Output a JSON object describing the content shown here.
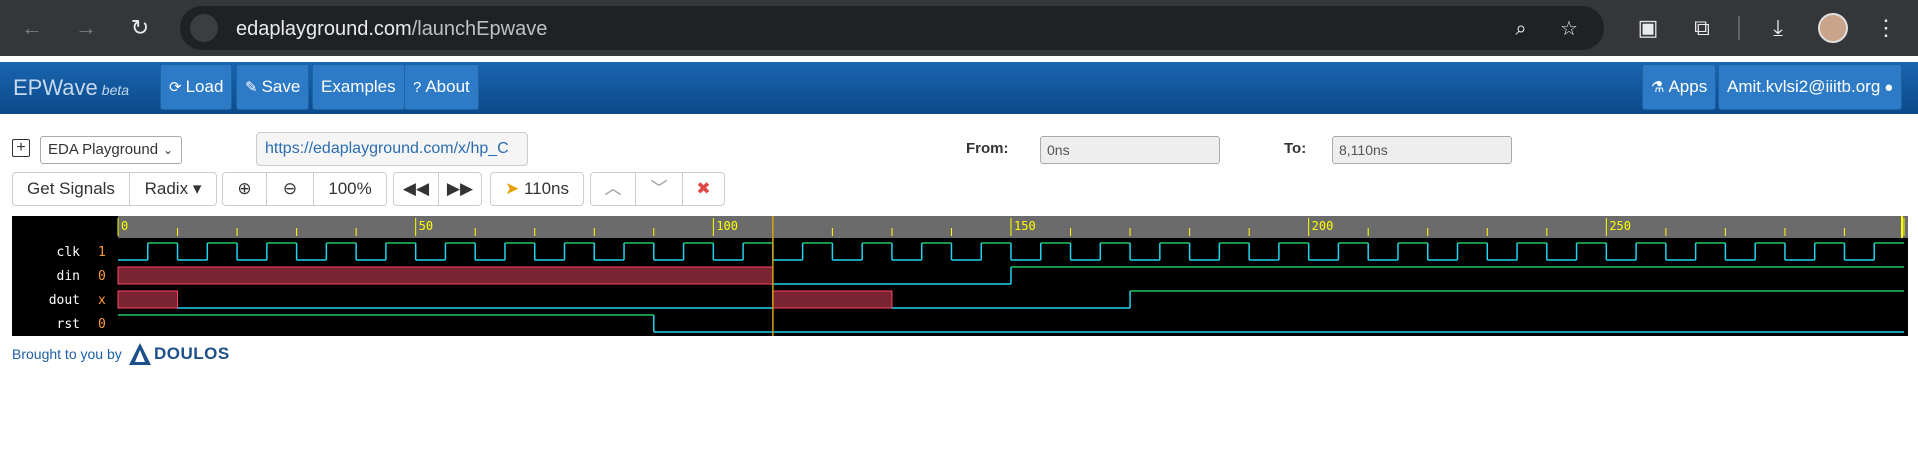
{
  "browser": {
    "url_domain": "edaplayground.com",
    "url_path": "/launchEpwave"
  },
  "app": {
    "brand": "EPWave",
    "brand_tag": "beta",
    "nav": {
      "load": "Load",
      "save": "Save",
      "examples": "Examples",
      "about": "About",
      "apps": "Apps",
      "user": "Amit.kvlsi2@iiitb.org"
    }
  },
  "controls": {
    "source_select": "EDA Playground",
    "share_url": "https://edaplayground.com/x/hp_C",
    "from_label": "From:",
    "from_value": "0ns",
    "to_label": "To:",
    "to_value": "8,110ns",
    "get_signals": "Get Signals",
    "radix": "Radix",
    "zoom_level": "100%",
    "cursor_time": "110ns"
  },
  "waveform": {
    "time_ticks": [
      "0",
      "50",
      "100",
      "150",
      "200",
      "250"
    ],
    "cursor_time_ns": 110,
    "visible_range_ns": [
      0,
      300
    ],
    "signals": [
      {
        "name": "clk",
        "value": "1"
      },
      {
        "name": "din",
        "value": "0"
      },
      {
        "name": "dout",
        "value": "x"
      },
      {
        "name": "rst",
        "value": "0"
      }
    ]
  },
  "footer": {
    "text": "Brought to you by",
    "brand": "DOULOS"
  },
  "colors": {
    "appbar": "#1965b0",
    "wave_bg": "#000000",
    "wave_green": "#22c55e",
    "wave_cyan": "#22d3ee",
    "wave_x_fill": "#7a2432",
    "ruler_bg": "#6b6b6b",
    "ruler_text": "#ffff00",
    "cursor": "#d4a017"
  }
}
